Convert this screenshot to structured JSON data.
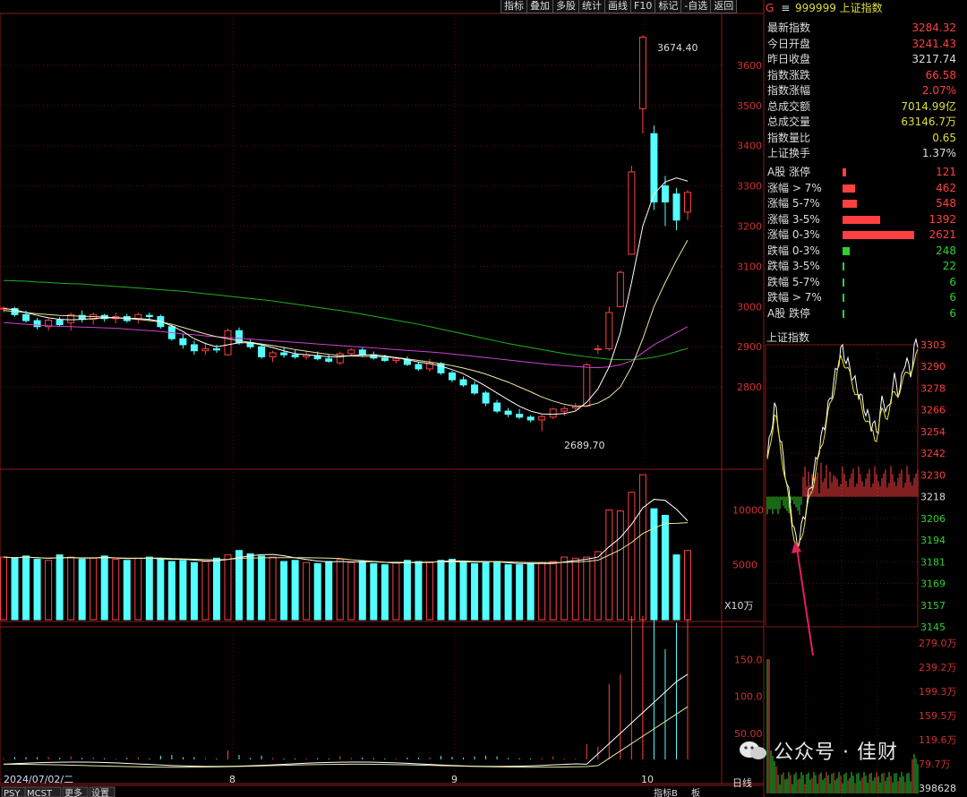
{
  "toolbar": [
    "指标",
    "叠加",
    "多股",
    "统计",
    "画线",
    "F10",
    "标记",
    "-自选",
    "返回"
  ],
  "header": {
    "code_prefix": "G",
    "menu_icon": "≡",
    "code": "999999",
    "name": "上证指数"
  },
  "quote": [
    {
      "label": "最新指数",
      "value": "3284.32",
      "color": "#ff4040"
    },
    {
      "label": "今日开盘",
      "value": "3241.43",
      "color": "#ff4040"
    },
    {
      "label": "昨日收盘",
      "value": "3217.74",
      "color": "#dddddd"
    },
    {
      "label": "指数涨跌",
      "value": "66.58",
      "color": "#ff4040"
    },
    {
      "label": "指数涨幅",
      "value": "2.07%",
      "color": "#ff4040"
    },
    {
      "label": "总成交额",
      "value": "7014.99亿",
      "color": "#dddd40"
    },
    {
      "label": "总成交量",
      "value": "63146.7万",
      "color": "#dddd40"
    },
    {
      "label": "指数量比",
      "value": "0.65",
      "color": "#dddd40"
    },
    {
      "label": "上证换手",
      "value": "1.37%",
      "color": "#dddddd"
    }
  ],
  "breadth": [
    {
      "label": "A股 涨停",
      "value": "121",
      "color": "#ff4040",
      "frac": 0.02
    },
    {
      "label": "涨幅 > 7%",
      "value": "462",
      "color": "#ff4040",
      "frac": 0.07
    },
    {
      "label": "涨幅 5-7%",
      "value": "548",
      "color": "#ff4040",
      "frac": 0.08
    },
    {
      "label": "涨幅 3-5%",
      "value": "1392",
      "color": "#ff4040",
      "frac": 0.21
    },
    {
      "label": "涨幅 0-3%",
      "value": "2621",
      "color": "#ff4040",
      "frac": 0.4
    },
    {
      "label": "跌幅 0-3%",
      "value": "248",
      "color": "#30d030",
      "frac": 0.04
    },
    {
      "label": "跌幅 3-5%",
      "value": "22",
      "color": "#30d030",
      "frac": 0.005
    },
    {
      "label": "跌幅 5-7%",
      "value": "6",
      "color": "#30d030",
      "frac": 0.003
    },
    {
      "label": "跌幅 > 7%",
      "value": "6",
      "color": "#30d030",
      "frac": 0.003
    },
    {
      "label": "A股 跌停",
      "value": "6",
      "color": "#30d030",
      "frac": 0.003
    }
  ],
  "intraday": {
    "title": "上证指数",
    "price_ticks": [
      "3303",
      "3290",
      "3278",
      "3266",
      "3254",
      "3242",
      "3230",
      "3218",
      "3206",
      "3194",
      "3181",
      "3169",
      "3157",
      "3145"
    ],
    "volume_ticks": [
      "279.0万",
      "239.2万",
      "199.3万",
      "159.5万",
      "119.6万",
      "79.7万",
      "398628"
    ]
  },
  "chart_data": {
    "type": "candlestick",
    "price_axis": [
      "3600",
      "3500",
      "3400",
      "3300",
      "3200",
      "3100",
      "3000",
      "2900",
      "2800"
    ],
    "ylim": [
      2690,
      3680
    ],
    "high_label": "3674.40",
    "low_label": "2689.70",
    "volume_axis": [
      "10000",
      "5000"
    ],
    "volume_unit": "X10万",
    "indicator_axis": [
      "150.0",
      "100.0",
      "50.00"
    ],
    "x_ticks": [
      "2024/07/02/二",
      "8",
      "9",
      "10"
    ],
    "bottom_tabs": [
      "PSY",
      "MCST",
      "更多",
      "设置"
    ],
    "right_tabs": [
      "指标B",
      "板"
    ],
    "period": "日线",
    "candles": [
      [
        2994,
        3000,
        2985,
        2996
      ],
      [
        2995,
        2999,
        2975,
        2980
      ],
      [
        2980,
        2990,
        2960,
        2965
      ],
      [
        2965,
        2972,
        2943,
        2950
      ],
      [
        2950,
        2972,
        2940,
        2966
      ],
      [
        2966,
        2974,
        2950,
        2955
      ],
      [
        2960,
        2985,
        2940,
        2980
      ],
      [
        2978,
        2990,
        2960,
        2968
      ],
      [
        2968,
        2985,
        2955,
        2980
      ],
      [
        2978,
        2982,
        2962,
        2970
      ],
      [
        2970,
        2985,
        2958,
        2975
      ],
      [
        2975,
        2982,
        2960,
        2965
      ],
      [
        2968,
        2985,
        2958,
        2980
      ],
      [
        2978,
        2985,
        2965,
        2975
      ],
      [
        2975,
        2980,
        2945,
        2950
      ],
      [
        2950,
        2955,
        2915,
        2920
      ],
      [
        2920,
        2932,
        2895,
        2905
      ],
      [
        2905,
        2915,
        2880,
        2890
      ],
      [
        2890,
        2910,
        2880,
        2895
      ],
      [
        2895,
        2905,
        2885,
        2892
      ],
      [
        2880,
        2945,
        2878,
        2940
      ],
      [
        2940,
        2948,
        2905,
        2910
      ],
      [
        2910,
        2918,
        2895,
        2900
      ],
      [
        2900,
        2905,
        2870,
        2875
      ],
      [
        2875,
        2890,
        2862,
        2885
      ],
      [
        2885,
        2900,
        2873,
        2880
      ],
      [
        2880,
        2892,
        2870,
        2875
      ],
      [
        2875,
        2888,
        2868,
        2880
      ],
      [
        2878,
        2888,
        2866,
        2870
      ],
      [
        2870,
        2880,
        2860,
        2864
      ],
      [
        2860,
        2888,
        2855,
        2883
      ],
      [
        2883,
        2896,
        2876,
        2892
      ],
      [
        2892,
        2898,
        2874,
        2880
      ],
      [
        2880,
        2888,
        2868,
        2872
      ],
      [
        2872,
        2880,
        2862,
        2866
      ],
      [
        2866,
        2875,
        2858,
        2870
      ],
      [
        2868,
        2876,
        2852,
        2856
      ],
      [
        2856,
        2862,
        2840,
        2845
      ],
      [
        2845,
        2870,
        2838,
        2858
      ],
      [
        2858,
        2862,
        2830,
        2835
      ],
      [
        2835,
        2840,
        2812,
        2818
      ],
      [
        2818,
        2826,
        2800,
        2805
      ],
      [
        2805,
        2815,
        2780,
        2785
      ],
      [
        2785,
        2790,
        2752,
        2760
      ],
      [
        2760,
        2768,
        2735,
        2740
      ],
      [
        2740,
        2748,
        2725,
        2732
      ],
      [
        2732,
        2745,
        2720,
        2725
      ],
      [
        2725,
        2730,
        2712,
        2718
      ],
      [
        2718,
        2732,
        2690,
        2726
      ],
      [
        2725,
        2748,
        2720,
        2745
      ],
      [
        2740,
        2752,
        2728,
        2746
      ],
      [
        2748,
        2760,
        2740,
        2752
      ],
      [
        2752,
        2860,
        2750,
        2855
      ],
      [
        2895,
        2905,
        2882,
        2895
      ],
      [
        2895,
        3000,
        2890,
        2985
      ],
      [
        3000,
        3090,
        2998,
        3085
      ],
      [
        3130,
        3350,
        3130,
        3335
      ],
      [
        3492,
        3674,
        3430,
        3670
      ],
      [
        3430,
        3450,
        3240,
        3260
      ],
      [
        3300,
        3325,
        3200,
        3260
      ],
      [
        3280,
        3295,
        3190,
        3215
      ],
      [
        3235,
        3290,
        3215,
        3284
      ]
    ],
    "volumes": [
      5.7,
      5.6,
      5.8,
      5.5,
      5.4,
      5.9,
      5.7,
      5.5,
      5.6,
      5.8,
      5.5,
      5.4,
      5.6,
      5.7,
      5.5,
      5.3,
      5.4,
      5.2,
      5.3,
      5.6,
      5.9,
      6.3,
      6.0,
      5.8,
      5.7,
      5.3,
      5.4,
      5.2,
      5.1,
      5.3,
      5.5,
      5.2,
      5.3,
      5.1,
      5.0,
      5.2,
      5.4,
      5.3,
      5.2,
      5.4,
      5.5,
      5.3,
      5.1,
      5.2,
      5.3,
      5.0,
      5.0,
      5.1,
      5.2,
      5.3,
      5.7,
      5.6,
      5.7,
      6.2,
      10.0,
      9.9,
      11.6,
      13.2,
      10.1,
      9.5,
      5.9,
      6.3
    ],
    "ma_short": [
      2995,
      2992,
      2985,
      2978,
      2972,
      2968,
      2967,
      2968,
      2970,
      2972,
      2972,
      2971,
      2970,
      2968,
      2963,
      2952,
      2938,
      2920,
      2908,
      2900,
      2905,
      2910,
      2910,
      2905,
      2898,
      2890,
      2883,
      2880,
      2878,
      2875,
      2875,
      2878,
      2880,
      2880,
      2877,
      2873,
      2868,
      2862,
      2858,
      2852,
      2843,
      2833,
      2818,
      2802,
      2785,
      2768,
      2752,
      2740,
      2733,
      2732,
      2734,
      2740,
      2762,
      2795,
      2850,
      2935,
      3060,
      3200,
      3280,
      3310,
      3320,
      3312
    ],
    "ma_mid": [
      2990,
      2988,
      2985,
      2982,
      2980,
      2978,
      2977,
      2976,
      2975,
      2974,
      2972,
      2970,
      2968,
      2965,
      2962,
      2956,
      2948,
      2940,
      2932,
      2925,
      2920,
      2915,
      2911,
      2907,
      2903,
      2898,
      2893,
      2889,
      2885,
      2881,
      2878,
      2877,
      2876,
      2876,
      2875,
      2873,
      2870,
      2866,
      2862,
      2858,
      2853,
      2847,
      2840,
      2832,
      2822,
      2812,
      2800,
      2788,
      2775,
      2765,
      2757,
      2752,
      2753,
      2760,
      2775,
      2800,
      2850,
      2920,
      3000,
      3060,
      3115,
      3165
    ],
    "ma_long": [
      2960,
      2958,
      2956,
      2954,
      2952,
      2951,
      2950,
      2949,
      2948,
      2947,
      2946,
      2944,
      2942,
      2940,
      2938,
      2935,
      2932,
      2930,
      2927,
      2925,
      2923,
      2921,
      2919,
      2917,
      2915,
      2913,
      2911,
      2909,
      2907,
      2905,
      2903,
      2901,
      2899,
      2897,
      2895,
      2893,
      2891,
      2889,
      2887,
      2885,
      2882,
      2879,
      2876,
      2873,
      2870,
      2867,
      2864,
      2861,
      2858,
      2855,
      2853,
      2851,
      2849,
      2848,
      2850,
      2855,
      2865,
      2885,
      2905,
      2920,
      2935,
      2950
    ],
    "ma_year": [
      3065,
      3064,
      3063,
      3061,
      3060,
      3058,
      3057,
      3056,
      3054,
      3052,
      3050,
      3048,
      3046,
      3044,
      3042,
      3040,
      3038,
      3035,
      3032,
      3029,
      3026,
      3023,
      3020,
      3017,
      3014,
      3010,
      3006,
      3002,
      2998,
      2994,
      2990,
      2986,
      2981,
      2976,
      2971,
      2966,
      2961,
      2956,
      2950,
      2944,
      2938,
      2932,
      2926,
      2920,
      2914,
      2908,
      2903,
      2898,
      2893,
      2888,
      2883,
      2879,
      2875,
      2872,
      2869,
      2868,
      2868,
      2870,
      2874,
      2880,
      2888,
      2896
    ]
  },
  "watermark": "公众号 · 佳财"
}
